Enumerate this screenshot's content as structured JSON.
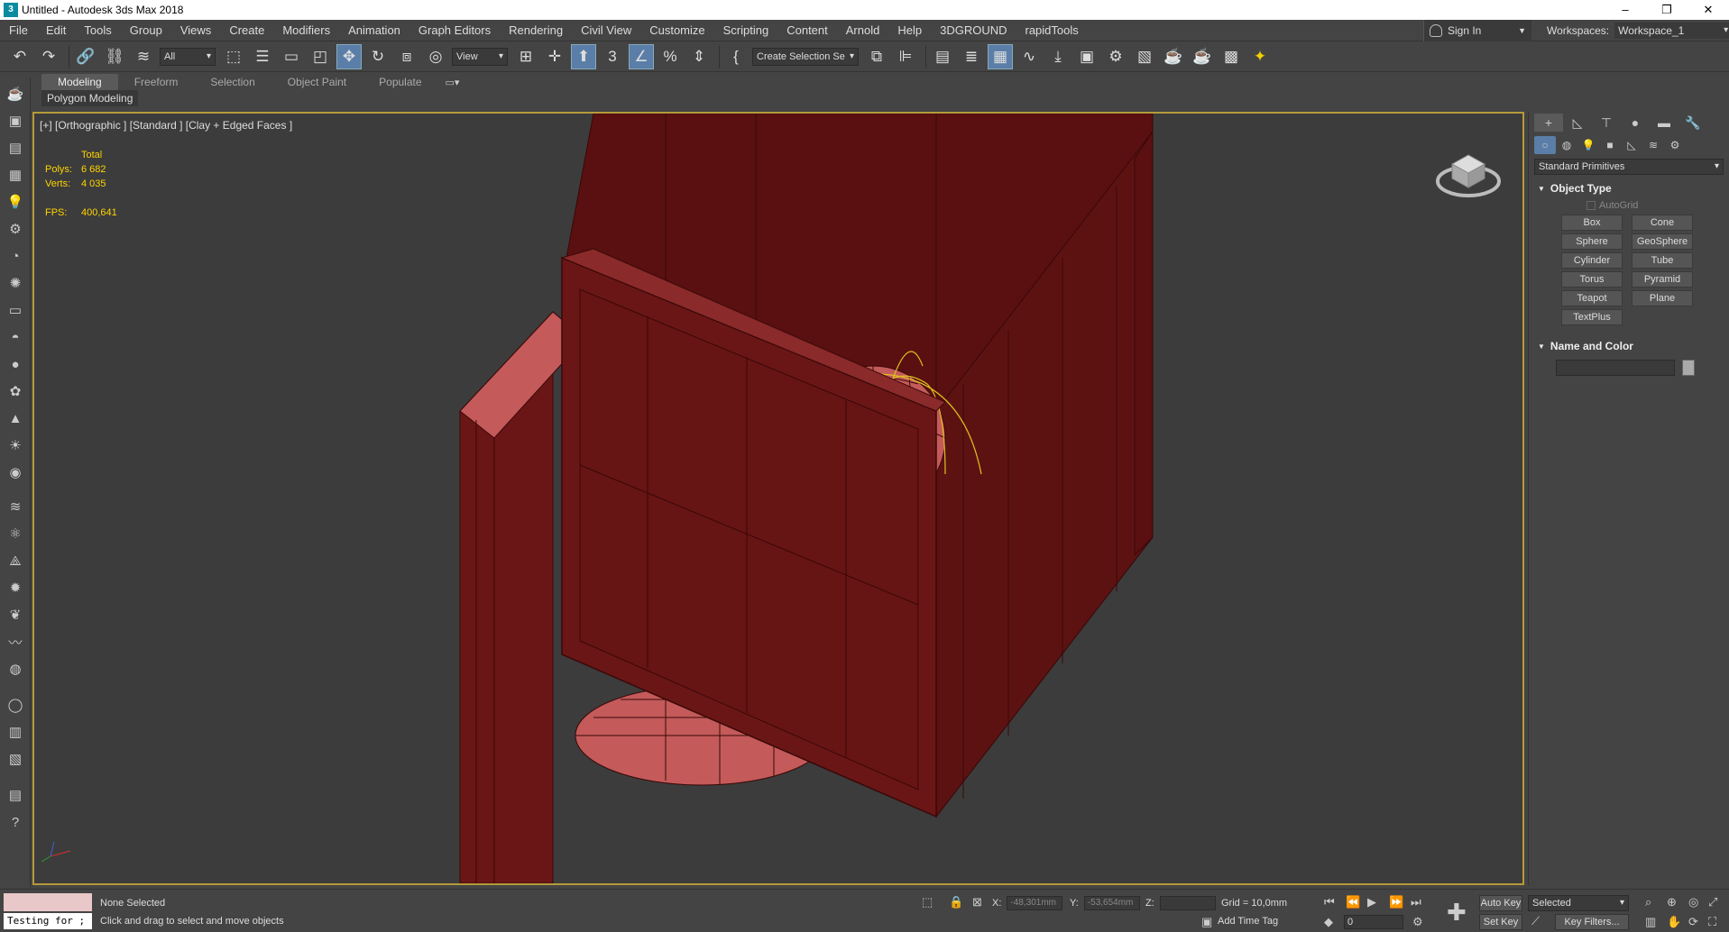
{
  "window": {
    "title": "Untitled - Autodesk 3ds Max 2018",
    "app_icon": "3"
  },
  "menu": {
    "items": [
      "File",
      "Edit",
      "Tools",
      "Group",
      "Views",
      "Create",
      "Modifiers",
      "Animation",
      "Graph Editors",
      "Rendering",
      "Civil View",
      "Customize",
      "Scripting",
      "Content",
      "Arnold",
      "Help",
      "3DGROUND",
      "rapidTools"
    ],
    "sign_in": "Sign In",
    "workspaces_label": "Workspaces:",
    "workspace_value": "Workspace_1"
  },
  "toolbar": {
    "filter": "All",
    "ref_coord": "View",
    "selection_set": "Create Selection Se"
  },
  "ribbon": {
    "tabs": [
      "Modeling",
      "Freeform",
      "Selection",
      "Object Paint",
      "Populate"
    ],
    "active_tab": "Modeling",
    "subtab": "Polygon Modeling"
  },
  "viewport": {
    "label": "[+] [Orthographic ] [Standard ] [Clay + Edged Faces ]",
    "stats_header": "Total",
    "polys_label": "Polys:",
    "polys_value": "6 682",
    "verts_label": "Verts:",
    "verts_value": "4 035",
    "fps_label": "FPS:",
    "fps_value": "400,641",
    "object_color": "#6b1616",
    "wire_color": "#3a0808",
    "frame_color": "#b59a3a"
  },
  "command_panel": {
    "dropdown": "Standard Primitives",
    "object_type_title": "Object Type",
    "autogrid": "AutoGrid",
    "primitives": [
      "Box",
      "Cone",
      "Sphere",
      "GeoSphere",
      "Cylinder",
      "Tube",
      "Torus",
      "Pyramid",
      "Teapot",
      "Plane",
      "TextPlus"
    ],
    "name_color_title": "Name and Color"
  },
  "status": {
    "listener_text": "Testing for ;",
    "selection": "None Selected",
    "prompt": "Click and drag to select and move objects",
    "x_label": "X:",
    "x_value": "-48,301mm",
    "y_label": "Y:",
    "y_value": "-53,654mm",
    "z_label": "Z:",
    "z_value": "",
    "grid": "Grid = 10,0mm",
    "add_time_tag": "Add Time Tag",
    "auto_key": "Auto Key",
    "set_key": "Set Key",
    "selected_drop": "Selected",
    "key_filters": "Key Filters...",
    "frame": "0"
  }
}
